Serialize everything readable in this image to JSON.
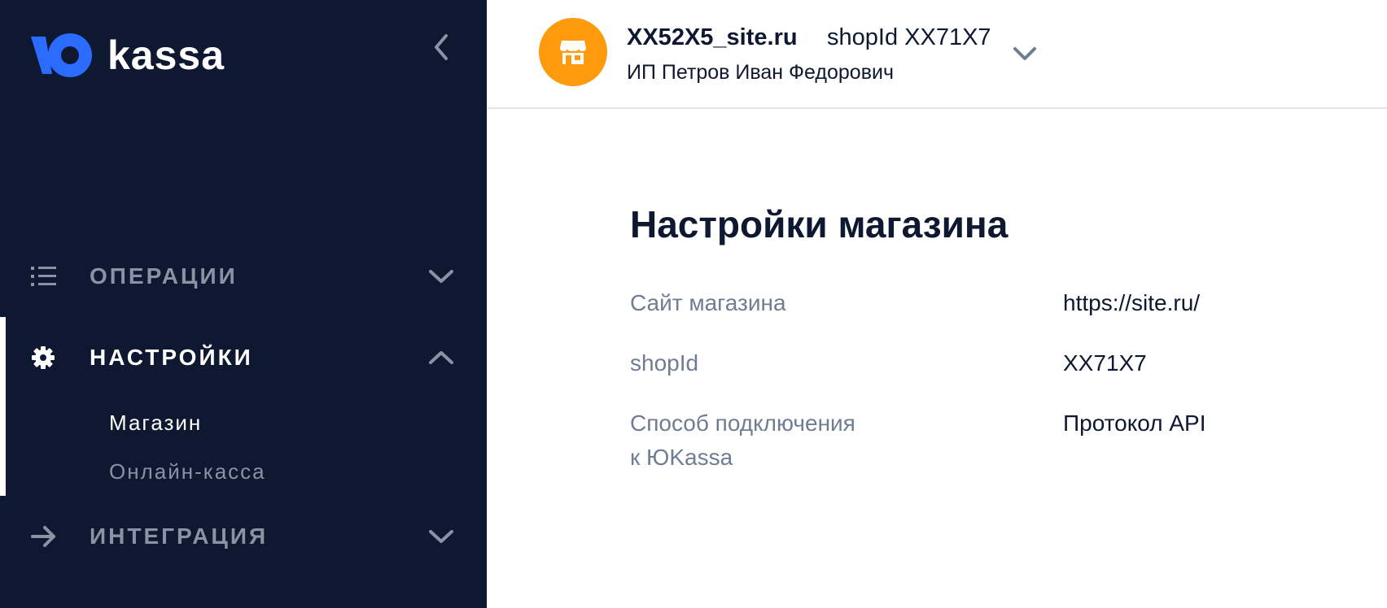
{
  "brand": {
    "logo_text": "kassa",
    "accent_color": "#2b6bff"
  },
  "sidebar": {
    "background": "#0e1830",
    "collapse_icon": "chevron-left-icon",
    "items": [
      {
        "label": "ОПЕРАЦИИ",
        "icon": "list-icon",
        "chevron": "chevron-down-icon",
        "active": false
      },
      {
        "label": "НАСТРОЙКИ",
        "icon": "gear-icon",
        "chevron": "chevron-up-icon",
        "active": true,
        "children": [
          {
            "label": "Магазин",
            "selected": true
          },
          {
            "label": "Онлайн-касса",
            "selected": false
          }
        ]
      },
      {
        "label": "ИНТЕГРАЦИЯ",
        "icon": "arrow-right-icon",
        "chevron": "chevron-down-icon",
        "active": false
      }
    ]
  },
  "header": {
    "shop_name": "XX52X5_site.ru",
    "shop_id": "shopId XX71X7",
    "owner": "ИП Петров Иван Федорович",
    "avatar_icon": "store-icon",
    "avatar_color": "#fd9a0e",
    "dropdown_icon": "chevron-down-icon"
  },
  "main": {
    "title": "Настройки магазина",
    "rows": [
      {
        "label": "Сайт магазина",
        "value": "https://site.ru/"
      },
      {
        "label": "shopId",
        "value": "XX71X7"
      },
      {
        "label_line1": "Способ подключения",
        "label_line2": "к ЮKassa",
        "value": "Протокол API"
      }
    ]
  }
}
